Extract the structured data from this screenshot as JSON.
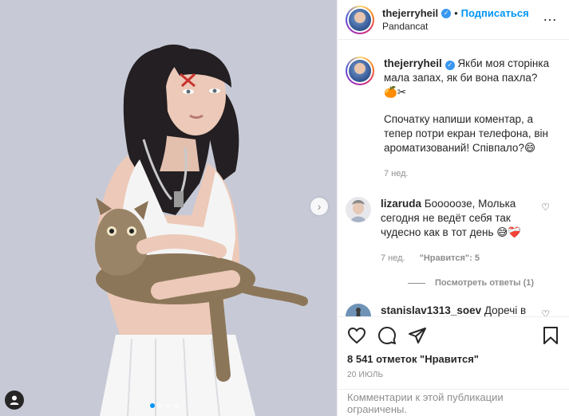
{
  "header": {
    "username": "thejerryheil",
    "separator": "•",
    "follow_label": "Подписаться",
    "location": "Pandancat",
    "more_icon": "…"
  },
  "caption": {
    "username": "thejerryheil",
    "text_1": "Якби моя сторінка мала запах, як би вона пахла?🍊✂",
    "text_2": "Спочатку напиши коментар, а тепер потри екран телефона, він ароматизований! Співпало?😄",
    "time": "7 нед."
  },
  "comments": [
    {
      "username": "lizaruda",
      "text": "Бооооозе, Молька сегодня не ведёт себя так чудесно как в тот день 😅❤️‍🩹",
      "time": "7 нед.",
      "likes": "\"Нравится\": 5",
      "replies": "Посмотреть ответы (1)"
    },
    {
      "username": "stanislav1313_soev",
      "text": "Доречі в мене знайомий художник, зараз робить серію картин під назвою \"Парфум\", на кожній з яких є"
    }
  ],
  "actions": {
    "likes": "8 541 отметок \"Нравится\"",
    "date": "20 ИЮЛЬ"
  },
  "footer": {
    "text": "Комментарии к этой публикации ограничены."
  },
  "carousel": {
    "total": 4,
    "active": 1
  },
  "colors": {
    "accent": "#0095f6",
    "verified": "#3897f0",
    "muted": "#8e8e8e",
    "text": "#262626"
  }
}
